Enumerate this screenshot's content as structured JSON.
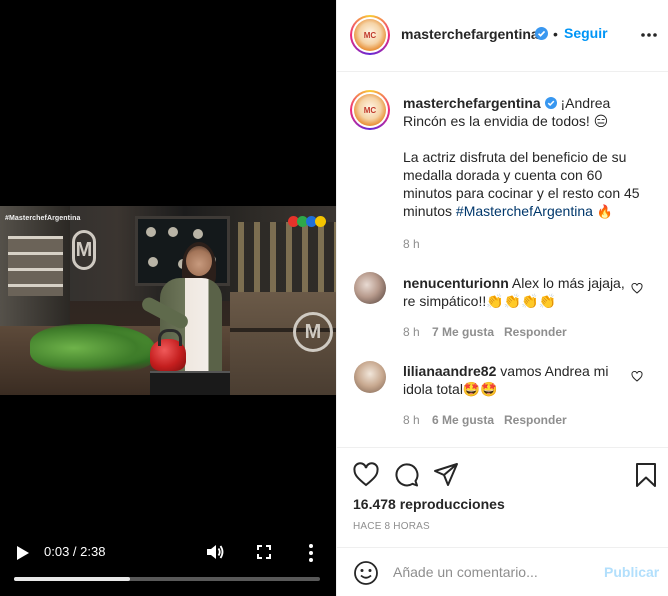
{
  "video": {
    "overlay_tag": "#MasterchefArgentina",
    "time": "0:03 / 2:38",
    "progress_fraction": 0.38,
    "icons": {
      "play": "play-icon",
      "volume": "volume-icon",
      "fullscreen": "fullscreen-icon",
      "more": "more-vertical-icon"
    }
  },
  "header": {
    "username": "masterchefargentina",
    "separator": "•",
    "follow_label": "Seguir",
    "verified": true
  },
  "caption": {
    "username": "masterchefargentina",
    "line1": "¡Andrea Rincón es la envidia de todos! 😑",
    "line2": "La actriz disfruta del beneficio de su medalla dorada y cuenta con 60 minutos para cocinar y el resto con 45 minutos ",
    "hashtag": "#MasterchefArgentina",
    "trailing_emoji": "🔥",
    "time": "8 h"
  },
  "comments": [
    {
      "username": "nenucenturionn",
      "text": "Alex lo más jajaja, re simpático!!👏👏👏👏",
      "time": "8 h",
      "likes": "7 Me gusta",
      "reply": "Responder"
    },
    {
      "username": "lilianaandre82",
      "text": "vamos Andrea mi idola total🤩🤩",
      "time": "8 h",
      "likes": "6 Me gusta",
      "reply": "Responder"
    }
  ],
  "stats": {
    "views": "16.478 reproducciones",
    "posted_ago": "HACE 8 HORAS"
  },
  "add_comment": {
    "placeholder": "Añade un comentario...",
    "post_label": "Publicar"
  },
  "colors": {
    "accent_blue": "#0095f6",
    "post_disabled": "#b2dffc",
    "muted": "#8e8e8e",
    "hashtag": "#00376b"
  }
}
